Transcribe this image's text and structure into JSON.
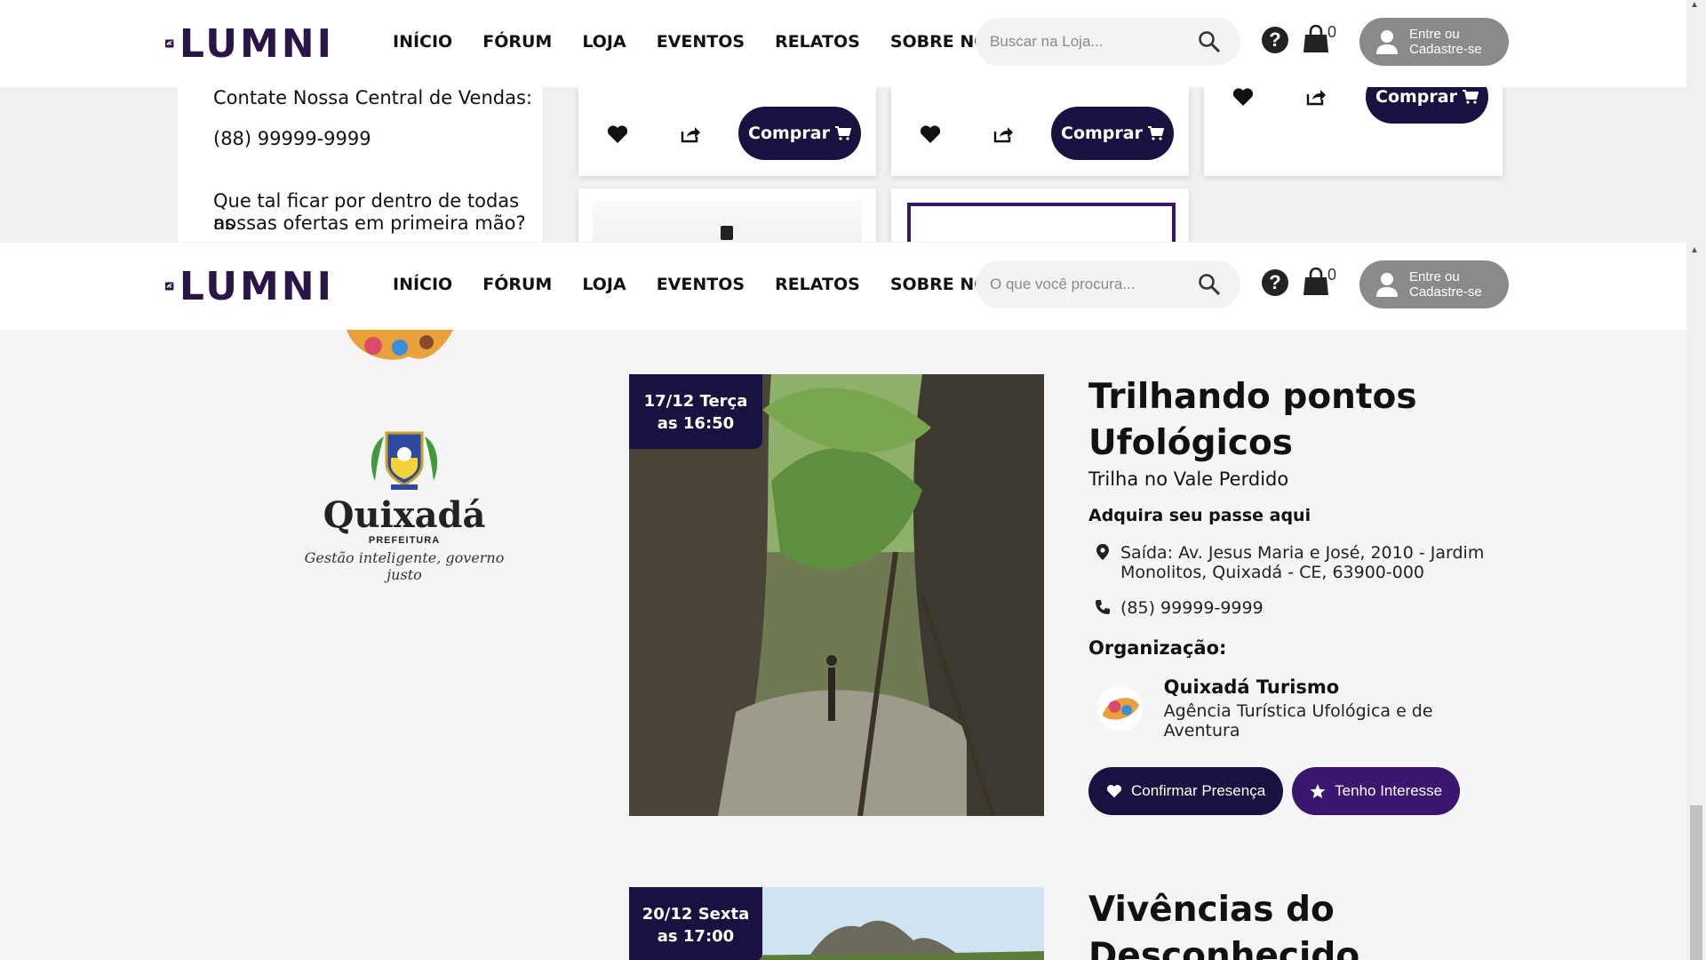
{
  "header": {
    "logo_text": "LUMNI",
    "nav": [
      "INÍCIO",
      "FÓRUM",
      "LOJA",
      "EVENTOS",
      "RELATOS",
      "SOBRE NÓS"
    ],
    "search_placeholder_top": "Buscar na Loja...",
    "search_placeholder_events": "O que você procura...",
    "cart_count": "0",
    "login_line1": "Entre ou",
    "login_line2": "Cadastre-se"
  },
  "store_strip": {
    "contact_title": "Contate Nossa Central de Vendas:",
    "contact_phone": "(88) 99999-9999",
    "newsletter_line1": "Que tal ficar por dentro de todas as",
    "newsletter_line2": "nossas ofertas em primeira mão?",
    "buy_label": "Comprar"
  },
  "sponsor": {
    "name": "Quixadá",
    "sub": "PREFEITURA",
    "slogan": "Gestão inteligente, governo justo"
  },
  "events": [
    {
      "date_line1": "17/12 Terça",
      "date_line2": "as 16:50",
      "title": "Trilhando pontos Ufológicos",
      "subtitle": "Trilha no Vale Perdido",
      "pass_label": "Adquira seu passe aqui",
      "address": "Saída: Av. Jesus Maria e José, 2010 - Jardim Monolitos, Quixadá - CE, 63900-000",
      "phone": "(85) 99999-9999",
      "org_heading": "Organização:",
      "org_name": "Quixadá Turismo",
      "org_desc": "Agência Turística Ufológica e de Aventura",
      "confirm_label": "Confirmar Presença",
      "interest_label": "Tenho Interesse"
    },
    {
      "date_line1": "20/12 Sexta",
      "date_line2": "as 17:00",
      "title": "Vivências do Desconhecido"
    }
  ],
  "colors": {
    "brand_dark": "#17123f",
    "brand_purple": "#3b1670",
    "header_bg": "#ffffff",
    "login_bg": "#8a8a8a"
  }
}
